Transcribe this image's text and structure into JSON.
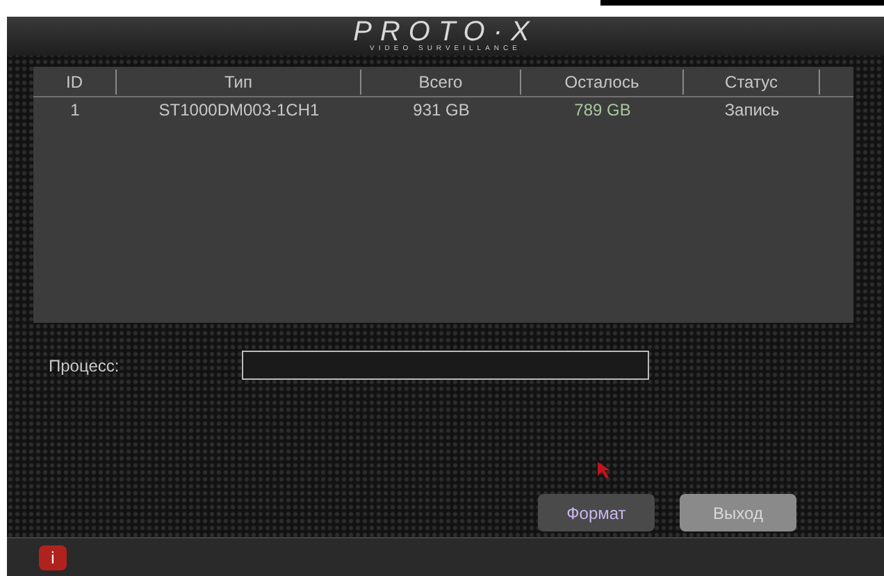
{
  "header": {
    "logo": "PROTO·X",
    "tagline": "VIDEO SURVEILLANCE"
  },
  "table": {
    "columns": [
      "ID",
      "Тип",
      "Всего",
      "Осталось",
      "Статус"
    ],
    "rows": [
      {
        "cells": [
          "1",
          "ST1000DM003-1CH1",
          "931 GB",
          "789 GB",
          "Запись"
        ]
      }
    ]
  },
  "process": {
    "label": "Процесс:",
    "level": 0
  },
  "buttons": [
    {
      "label": "Формат",
      "selected": true
    },
    {
      "label": "Выход",
      "selected": false
    }
  ],
  "status_bar": {
    "icon_text": "i"
  }
}
